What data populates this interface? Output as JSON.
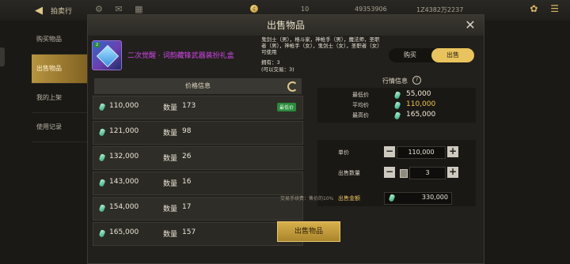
{
  "background": {
    "title": "拍卖行",
    "currency_1": "10",
    "currency_2": "49353906",
    "currency_3": "1Z4382万2237",
    "tabs": [
      {
        "label": "购买物品"
      },
      {
        "label": "出售物品"
      },
      {
        "label": "我的上架"
      },
      {
        "label": "使用记录"
      }
    ]
  },
  "modal": {
    "title": "出售物品",
    "item": {
      "name": "二次觉醒 · 词韵藏锋武器装扮礼盒",
      "desc": "鬼剑士（男），格斗家，神枪手（男），魔法师，圣职者（男），神枪手（女），鬼剑士（女），圣职者（女）可使用",
      "owned": "拥有：3",
      "tradable": "(可以交易：3)"
    },
    "toggle": {
      "buy": "购买",
      "sell": "出售"
    },
    "price_header": "价格信息",
    "qty_label": "数量",
    "lowest_badge": "最低价",
    "listings": [
      {
        "price": "110,000",
        "qty": "173"
      },
      {
        "price": "121,000",
        "qty": "98"
      },
      {
        "price": "132,000",
        "qty": "26"
      },
      {
        "price": "143,000",
        "qty": "16"
      },
      {
        "price": "154,000",
        "qty": "17"
      },
      {
        "price": "165,000",
        "qty": "157"
      }
    ],
    "market": {
      "title": "行情信息",
      "min_label": "最低价",
      "min_value": "55,000",
      "avg_label": "平均价",
      "avg_value": "110,000",
      "max_label": "最高价",
      "max_value": "165,000"
    },
    "sell_form": {
      "unit_label": "单价",
      "unit_value": "110,000",
      "qty_label": "出售数量",
      "qty_value": "3",
      "total_label": "出售金额",
      "total_value": "330,000"
    },
    "fee_note": "交易手续费：售价的10%",
    "sell_button": "出售物品"
  },
  "colors": {
    "avg_price": "#f0c64a",
    "min_price": "#f3ecd8",
    "item_name": "#d046e8",
    "accent_gold": "#e9c35d"
  }
}
